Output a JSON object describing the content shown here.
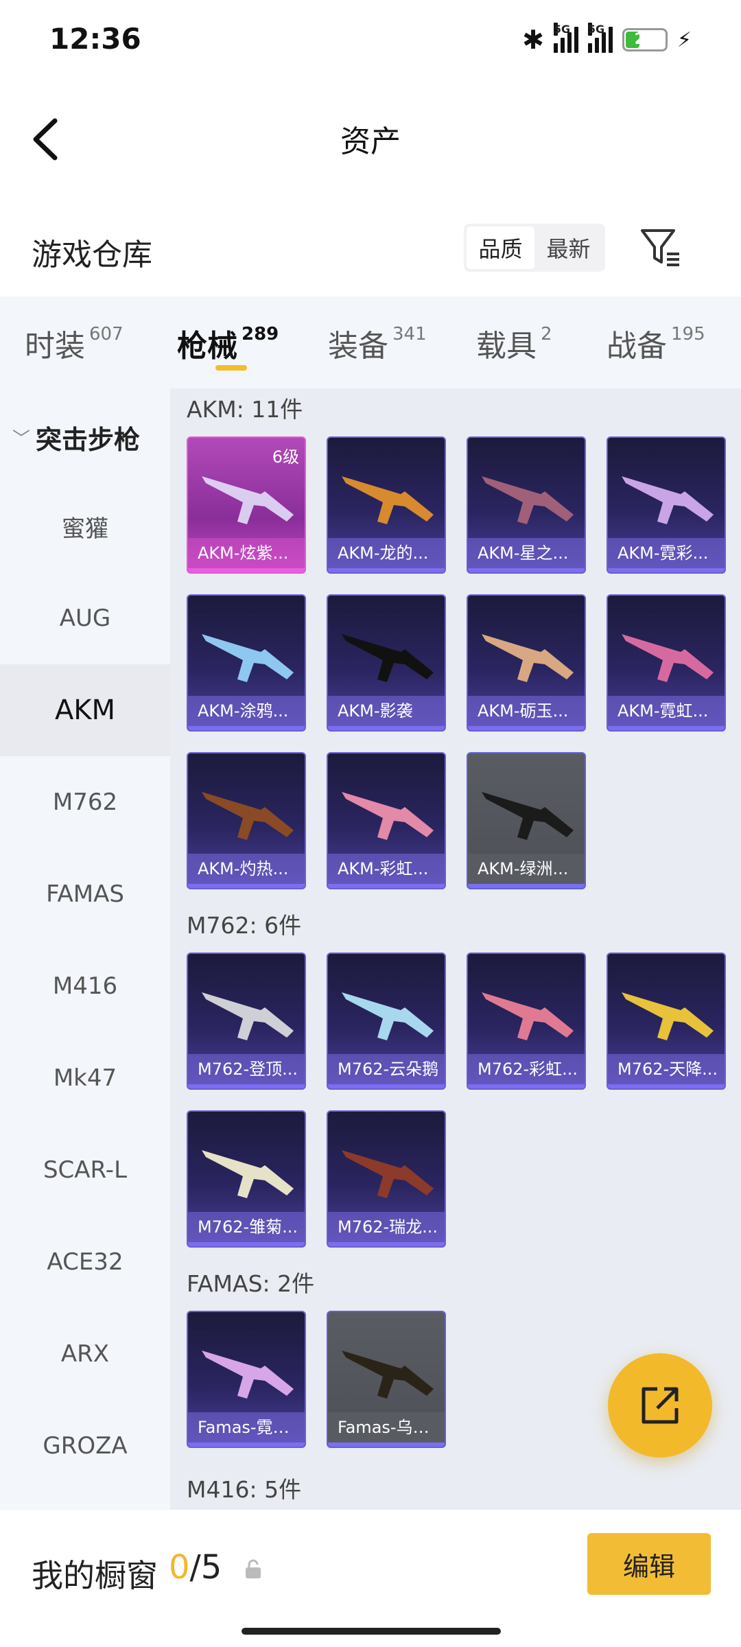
{
  "status": {
    "time": "12:36",
    "battery": "20",
    "net1": "5G",
    "net2": "5G"
  },
  "nav": {
    "title": "资产"
  },
  "header": {
    "title": "游戏仓库",
    "sort_options": [
      "品质",
      "最新"
    ]
  },
  "categories": [
    {
      "label": "时装",
      "count": "607"
    },
    {
      "label": "枪械",
      "count": "289"
    },
    {
      "label": "装备",
      "count": "341"
    },
    {
      "label": "载具",
      "count": "2"
    },
    {
      "label": "战备",
      "count": "195"
    }
  ],
  "side": {
    "group": "突击步枪",
    "items": [
      "蜜獾",
      "AUG",
      "AKM",
      "M762",
      "FAMAS",
      "M416",
      "Mk47",
      "SCAR-L",
      "ACE32",
      "ARX",
      "GROZA"
    ]
  },
  "groups": [
    {
      "title": "AKM: 11件",
      "items": [
        {
          "name": "AKM-炫紫...",
          "tag": "6级",
          "style": "purple"
        },
        {
          "name": "AKM-龙的..."
        },
        {
          "name": "AKM-星之..."
        },
        {
          "name": "AKM-霓彩..."
        },
        {
          "name": "AKM-涂鸦..."
        },
        {
          "name": "AKM-影袭"
        },
        {
          "name": "AKM-砺玉..."
        },
        {
          "name": "AKM-霓虹..."
        },
        {
          "name": "AKM-灼热..."
        },
        {
          "name": "AKM-彩虹..."
        },
        {
          "name": "AKM-绿洲...",
          "style": "grey"
        }
      ]
    },
    {
      "title": "M762: 6件",
      "items": [
        {
          "name": "M762-登顶..."
        },
        {
          "name": "M762-云朵鹅"
        },
        {
          "name": "M762-彩虹..."
        },
        {
          "name": "M762-天降..."
        },
        {
          "name": "M762-雏菊..."
        },
        {
          "name": "M762-瑞龙..."
        }
      ]
    },
    {
      "title": "FAMAS: 2件",
      "items": [
        {
          "name": "Famas-霓彩..."
        },
        {
          "name": "Famas-乌木...",
          "style": "grey"
        }
      ]
    },
    {
      "title": "M416: 5件",
      "items": []
    }
  ],
  "bottom": {
    "label": "我的橱窗",
    "current": "0",
    "total": "/5",
    "edit": "编辑"
  },
  "colors": {
    "accent": "#f2bd35",
    "card_border": "#6c5ecf"
  }
}
